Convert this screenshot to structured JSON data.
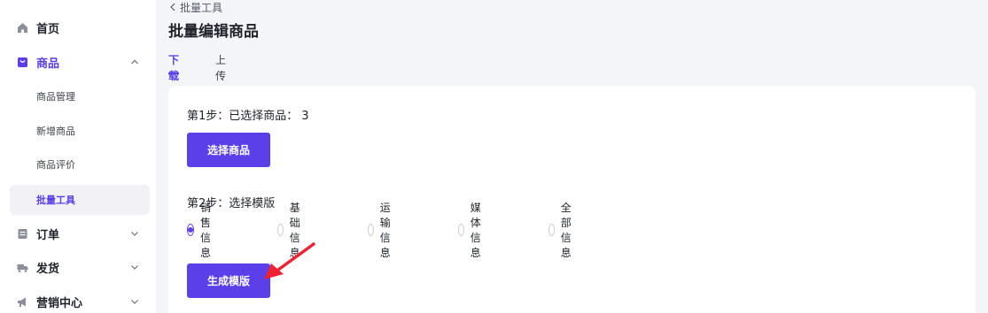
{
  "sidebar": {
    "items": [
      {
        "label": "首页",
        "icon": "home-icon"
      },
      {
        "label": "商品",
        "icon": "bag-icon",
        "expanded": true,
        "children": [
          {
            "label": "商品管理"
          },
          {
            "label": "新增商品"
          },
          {
            "label": "商品评价"
          },
          {
            "label": "批量工具",
            "active": true
          }
        ]
      },
      {
        "label": "订单",
        "icon": "order-icon",
        "expanded": false
      },
      {
        "label": "发货",
        "icon": "truck-icon",
        "expanded": false
      },
      {
        "label": "营销中心",
        "icon": "megaphone-icon",
        "expanded": false
      }
    ]
  },
  "header": {
    "breadcrumb": "批量工具",
    "title": "批量编辑商品"
  },
  "tabs": [
    {
      "label": "下载",
      "active": true
    },
    {
      "label": "上传",
      "active": false
    }
  ],
  "step1": {
    "label": "第1步：已选择商品：",
    "count": "3",
    "button": "选择商品"
  },
  "step2": {
    "label": "第2步：选择模版",
    "options": [
      {
        "label": "销售信息",
        "checked": true
      },
      {
        "label": "基础信息",
        "checked": false
      },
      {
        "label": "运输信息",
        "checked": false
      },
      {
        "label": "媒体信息",
        "checked": false
      },
      {
        "label": "全部信息",
        "checked": false
      }
    ],
    "button": "生成模版"
  },
  "colors": {
    "accent": "#5b3fe8",
    "annotation_arrow": "#ee2233"
  }
}
